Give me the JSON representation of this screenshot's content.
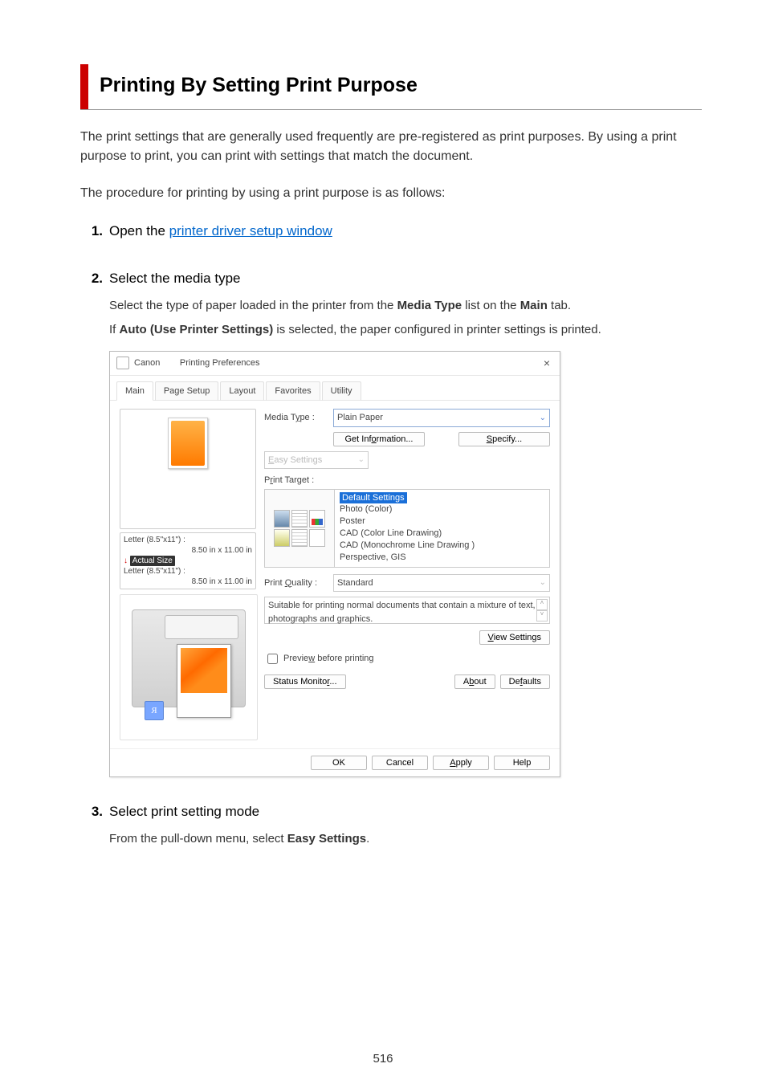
{
  "title": "Printing By Setting Print Purpose",
  "intro": "The print settings that are generally used frequently are pre-registered as print purposes. By using a print purpose to print, you can print with settings that match the document.",
  "procedure_intro": "The procedure for printing by using a print purpose is as follows:",
  "steps": {
    "1": {
      "num": "1.",
      "title_prefix": "Open the ",
      "link": "printer driver setup window"
    },
    "2": {
      "num": "2.",
      "title": "Select the media type",
      "body1_a": "Select the type of paper loaded in the printer from the ",
      "body1_b": "Media Type",
      "body1_c": " list on the ",
      "body1_d": "Main",
      "body1_e": " tab.",
      "body2_a": "If ",
      "body2_b": "Auto (Use Printer Settings)",
      "body2_c": " is selected, the paper configured in printer settings is printed."
    },
    "3": {
      "num": "3.",
      "title": "Select print setting mode",
      "body_a": "From the pull-down menu, select ",
      "body_b": "Easy Settings",
      "body_c": "."
    }
  },
  "dialog": {
    "title_prefix": "Canon",
    "title_suffix": "Printing Preferences",
    "close": "×",
    "tabs": {
      "main": "Main",
      "pagesetup": "Page Setup",
      "layout": "Layout",
      "favorites": "Favorites",
      "utility": "Utility"
    },
    "media_type_label": "Media Type :",
    "media_type_value": "Plain Paper",
    "media_type_ul": "y",
    "get_info": "Get Information...",
    "get_info_ul": "o",
    "specify": "Specify...",
    "specify_ul": "S",
    "easy_label": "Easy Settings",
    "easy_label_ul": "E",
    "print_target_label": "Print Target :",
    "print_target_ul": "r",
    "targets": {
      "0": "Default Settings",
      "1": "Photo (Color)",
      "2": "Poster",
      "3": "CAD (Color Line Drawing)",
      "4": "CAD (Monochrome Line Drawing )",
      "5": "Perspective, GIS"
    },
    "print_quality_label": "Print Quality :",
    "print_quality_ul": "Q",
    "print_quality_value": "Standard",
    "description": "Suitable for printing normal documents that contain a mixture of text, photographs and graphics.",
    "view_settings": "View Settings",
    "view_settings_ul": "V",
    "preview_cb": "Preview before printing",
    "preview_cb_ul": "w",
    "status_monitor": "Status Monitor...",
    "status_monitor_ul": "r",
    "about": "About",
    "about_ul": "b",
    "defaults": "Defaults",
    "defaults_ul": "f",
    "ok": "OK",
    "cancel": "Cancel",
    "apply": "Apply",
    "apply_ul": "A",
    "help": "Help",
    "size_a_label": "Letter (8.5\"x11\") :",
    "size_a_dim": "8.50 in x 11.00 in",
    "actual_size": "Actual Size",
    "size_b_label": "Letter (8.5\"x11\") :",
    "size_b_dim": "8.50 in x 11.00 in",
    "r_mark": "R"
  },
  "page_number": "516"
}
